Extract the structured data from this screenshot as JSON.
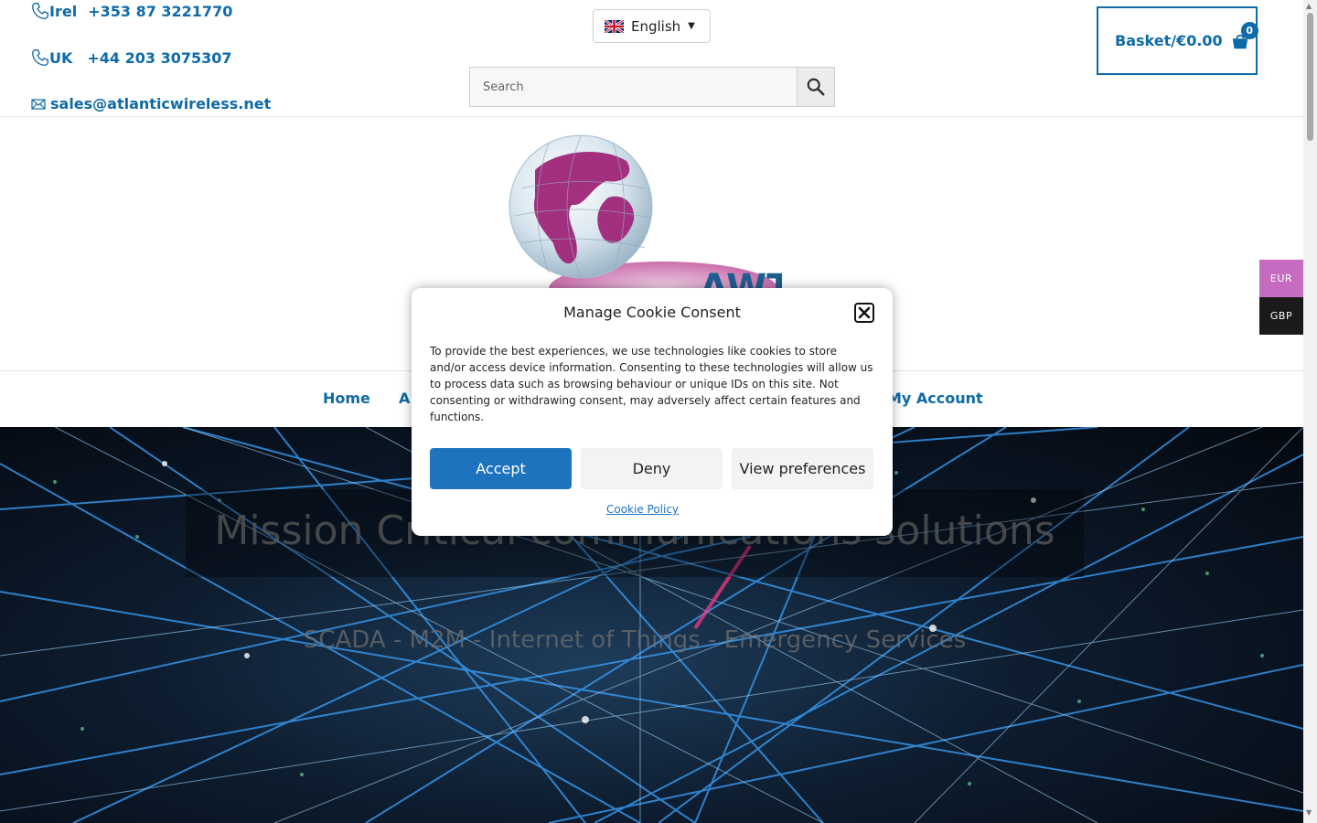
{
  "header": {
    "contacts": [
      {
        "label": "Irel",
        "phone": "+353 87 3221770",
        "icon": "phone-icon"
      },
      {
        "label": "UK",
        "phone": "+44 203 3075307",
        "icon": "phone-icon"
      },
      {
        "label": "",
        "email": "sales@atlanticwireless.net",
        "icon": "mail-icon"
      }
    ],
    "language": {
      "selected": "English",
      "flag": "uk-flag-icon"
    },
    "search": {
      "placeholder": "Search"
    },
    "basket": {
      "label": "Basket/€0.00",
      "count": "0"
    }
  },
  "logo": {
    "text": "AWT"
  },
  "nav": {
    "items": [
      {
        "label": "Home"
      },
      {
        "label": "A"
      },
      {
        "label": "My Account"
      }
    ]
  },
  "hero": {
    "title": "Mission Critical communications solutions",
    "subtitle": "SCADA - M2M - Internet of Things - Emergency Services"
  },
  "cookie_modal": {
    "title": "Manage Cookie Consent",
    "body": "To provide the best experiences, we use technologies like cookies to store and/or access device information. Consenting to these technologies will allow us to process data such as browsing behaviour or unique IDs on this site. Not consenting or withdrawing consent, may adversely affect certain features and functions.",
    "accept_label": "Accept",
    "deny_label": "Deny",
    "preferences_label": "View preferences",
    "policy_label": "Cookie Policy"
  },
  "currency": {
    "options": [
      "EUR",
      "GBP"
    ],
    "active": "EUR"
  },
  "colors": {
    "brand_blue": "#0e6aa8",
    "accept_blue": "#1e73be",
    "eur_pink": "#c66cc0",
    "logo_magenta": "#a3307f"
  }
}
